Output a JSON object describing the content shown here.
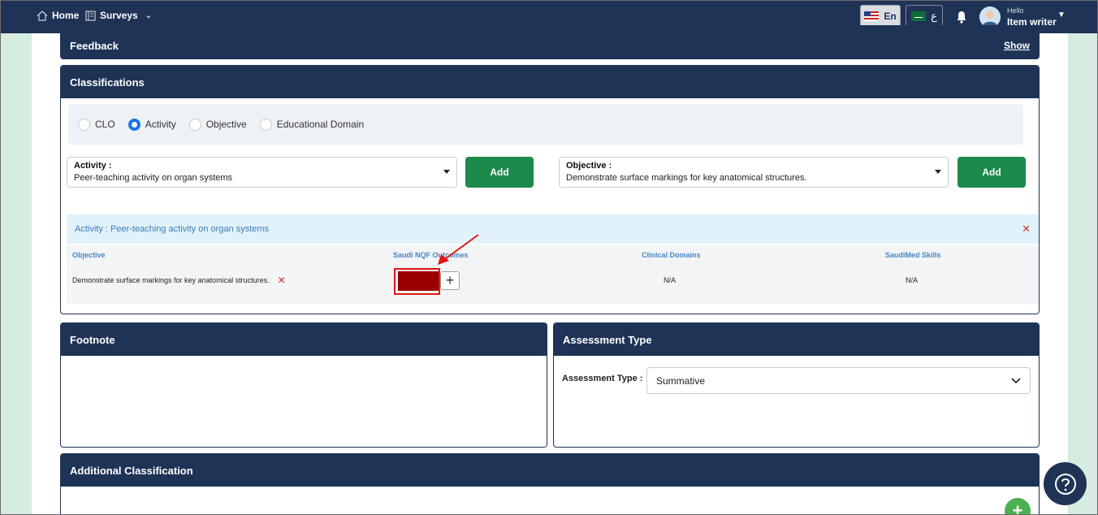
{
  "topbar": {
    "home_label": "Home",
    "surveys_label": "Surveys",
    "lang_en": "En",
    "lang_ar": "ع",
    "greeting": "Hello",
    "user_name": "Item writer"
  },
  "feedback": {
    "title": "Feedback",
    "show_label": "Show"
  },
  "classifications": {
    "title": "Classifications",
    "radio_options": [
      {
        "label": "CLO",
        "selected": false
      },
      {
        "label": "Activity",
        "selected": true
      },
      {
        "label": "Objective",
        "selected": false
      },
      {
        "label": "Educational Domain",
        "selected": false
      }
    ],
    "activity_select": {
      "label": "Activity :",
      "value": "Peer-teaching activity on organ systems"
    },
    "objective_select": {
      "label": "Objective :",
      "value": "Demonstrate surface markings for key anatomical structures."
    },
    "add_label": "Add",
    "activity_bar_text": "Activity : Peer-teaching activity on organ systems",
    "table": {
      "headers": [
        "Objective",
        "Saudi NQF Outcomes",
        "Clinical Domains",
        "SaudiMed Skills"
      ],
      "row": {
        "objective": "Demonstrate surface markings for key anatomical structures.",
        "clinical_domains": "N/A",
        "saudimed_skills": "N/A"
      }
    }
  },
  "footnote": {
    "title": "Footnote"
  },
  "assessment": {
    "title": "Assessment Type",
    "label": "Assessment Type :",
    "value": "Summative"
  },
  "additional": {
    "title": "Additional Classification"
  },
  "colors": {
    "navy": "#1e3356",
    "green": "#1b8a4a",
    "swatch": "#9a0000",
    "highlight": "#e21414"
  }
}
